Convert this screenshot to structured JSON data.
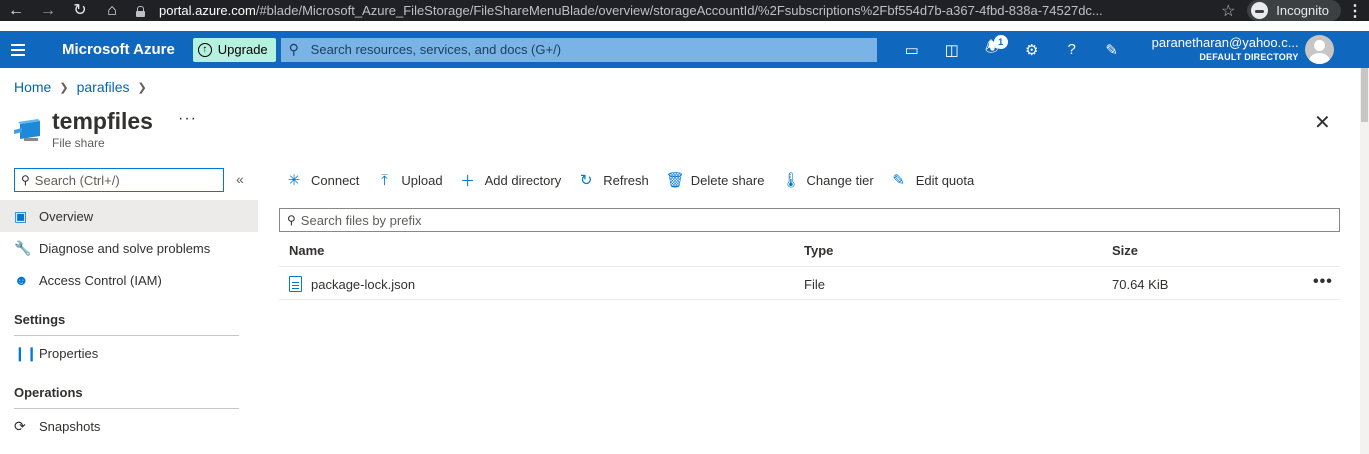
{
  "browser": {
    "url_host": "portal.azure.com",
    "url_path": "/#blade/Microsoft_Azure_FileStorage/FileShareMenuBlade/overview/storageAccountId/%2Fsubscriptions%2Fbf554d7b-a367-4fbd-838a-74527dc...",
    "incognito_label": "Incognito"
  },
  "header": {
    "brand": "Microsoft Azure",
    "upgrade_label": "Upgrade",
    "search_placeholder": "Search resources, services, and docs (G+/)",
    "notification_count": "1",
    "account_email": "paranetharan@yahoo.c...",
    "account_directory": "DEFAULT DIRECTORY"
  },
  "breadcrumb": {
    "items": [
      "Home",
      "parafiles"
    ]
  },
  "resource": {
    "title": "tempfiles",
    "subtitle": "File share"
  },
  "sidebar": {
    "search_placeholder": "Search (Ctrl+/)",
    "items": [
      {
        "label": "Overview",
        "icon": "file-share-icon"
      },
      {
        "label": "Diagnose and solve problems",
        "icon": "wrench-icon"
      },
      {
        "label": "Access Control (IAM)",
        "icon": "people-icon"
      }
    ],
    "sections": [
      {
        "title": "Settings",
        "items": [
          {
            "label": "Properties",
            "icon": "properties-icon"
          }
        ]
      },
      {
        "title": "Operations",
        "items": [
          {
            "label": "Snapshots",
            "icon": "snapshots-icon"
          }
        ]
      }
    ]
  },
  "toolbar": {
    "buttons": [
      {
        "label": "Connect",
        "icon": "plug-icon"
      },
      {
        "label": "Upload",
        "icon": "upload-icon"
      },
      {
        "label": "Add directory",
        "icon": "plus-icon"
      },
      {
        "label": "Refresh",
        "icon": "refresh-icon"
      },
      {
        "label": "Delete share",
        "icon": "trash-icon"
      },
      {
        "label": "Change tier",
        "icon": "thermometer-icon"
      },
      {
        "label": "Edit quota",
        "icon": "pencil-icon"
      }
    ]
  },
  "files": {
    "search_placeholder": "Search files by prefix",
    "columns": [
      "Name",
      "Type",
      "Size"
    ],
    "rows": [
      {
        "name": "package-lock.json",
        "type": "File",
        "size": "70.64 KiB"
      }
    ]
  }
}
